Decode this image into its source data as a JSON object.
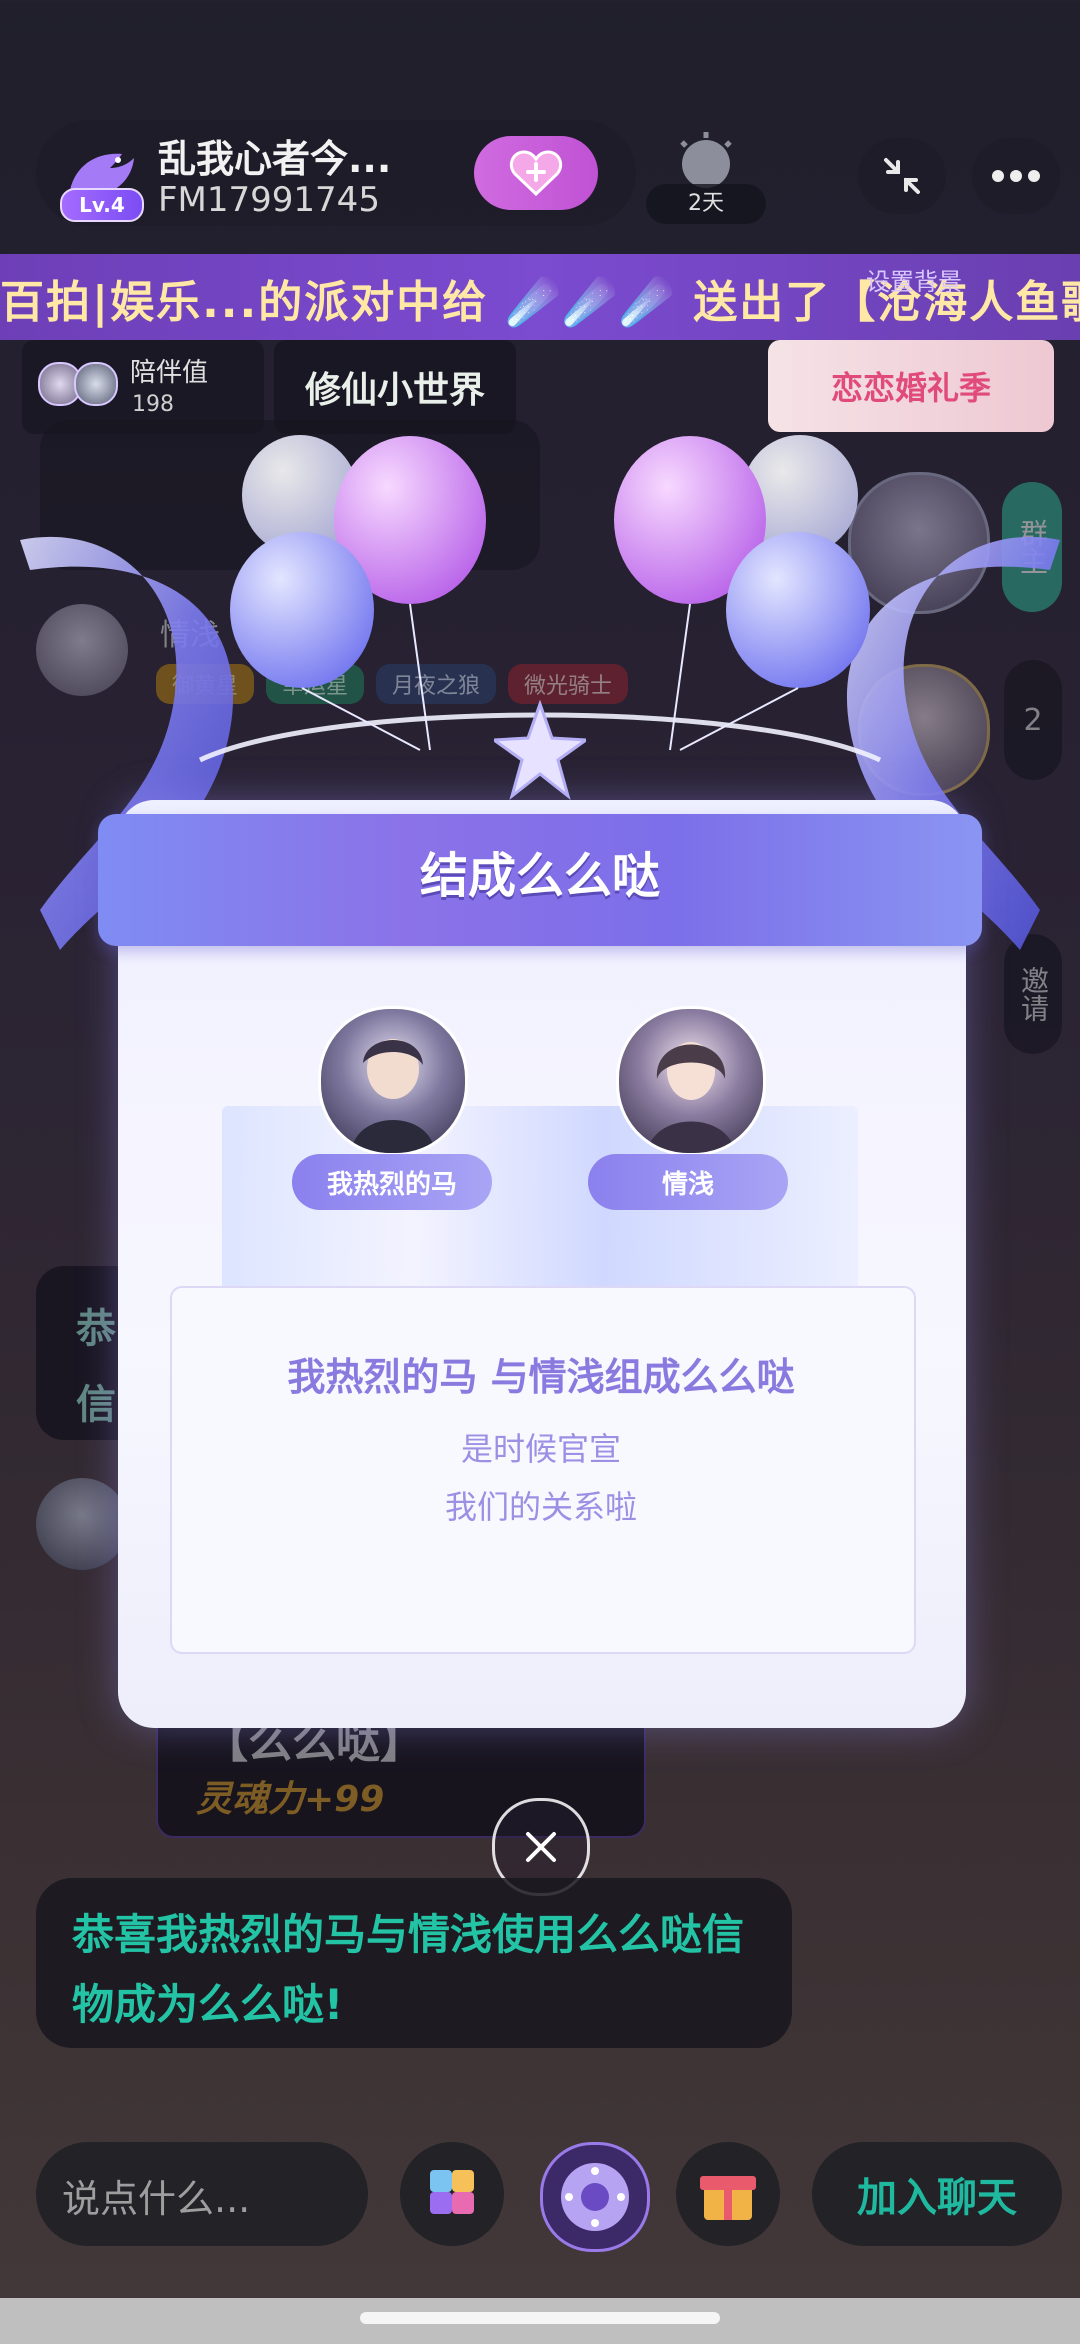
{
  "header": {
    "room_title": "乱我心者今...",
    "room_id": "FM17991745",
    "level": "Lv.4",
    "days": "2天"
  },
  "marquee": {
    "text": "百拍|娱乐...的派对中给 ☄️☄️☄️ 送出了【沧海人鱼歌",
    "right_hint": "设置背景"
  },
  "row2": {
    "companion_label": "陪伴值",
    "companion_value": "198",
    "xiuxian_label": "修仙小世界",
    "wedding_label": "恋恋婚礼季"
  },
  "background": {
    "tags": [
      "御黄星",
      "幸运星",
      "月夜之狼",
      "微光骑士"
    ],
    "user_name": "情浅",
    "side_badge_number": "2",
    "side_group_label": "群主",
    "side_invite_label": "邀请",
    "partial_text_1": "恭",
    "partial_text_2": "信",
    "item_name": "【么么哒】",
    "item_power": "灵魂力+99"
  },
  "modal": {
    "title": "结成么么哒",
    "user1_name": "我热烈的马",
    "user2_name": "情浅",
    "message_main": "我热烈的马 与情浅组成么么哒",
    "message_sub1": "是时候官宣",
    "message_sub2": "我们的关系啦"
  },
  "congrats": {
    "text": "恭喜我热烈的马与情浅使用么么哒信物成为么么哒!"
  },
  "bottom": {
    "input_placeholder": "说点什么...",
    "join_label": "加入聊天"
  },
  "colors": {
    "accent_purple": "#8b72e8",
    "teal_text": "#23c4a6",
    "marquee_bg": "#6d3fb7"
  }
}
